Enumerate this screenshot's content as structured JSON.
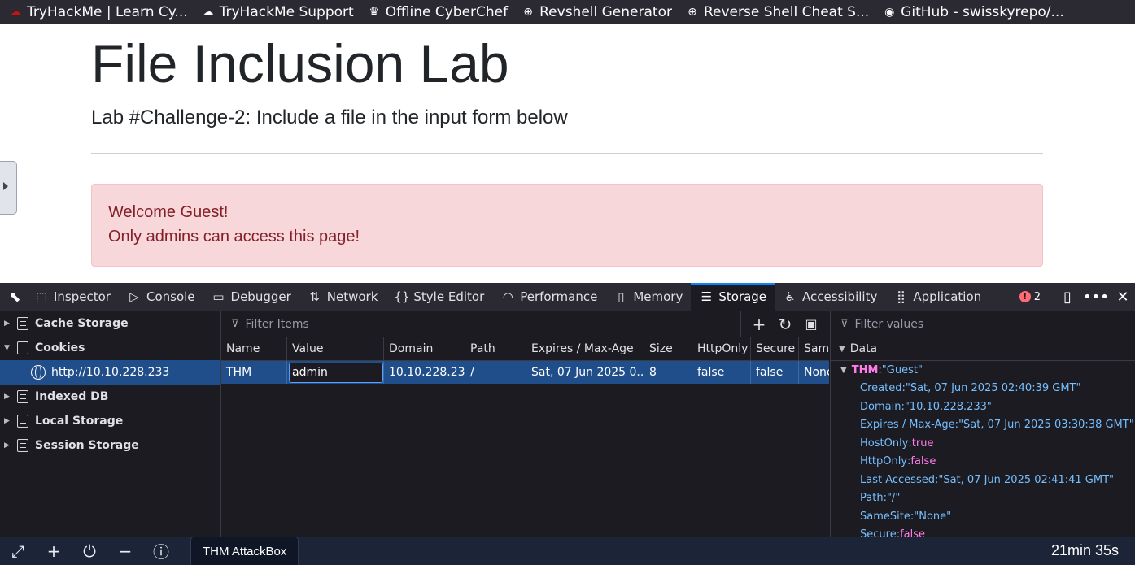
{
  "bookmarks": [
    {
      "icon": "tryhackme-icon",
      "label": "TryHackMe | Learn Cy..."
    },
    {
      "icon": "cloud-icon",
      "label": "TryHackMe Support"
    },
    {
      "icon": "chef-hat-icon",
      "label": "Offline CyberChef"
    },
    {
      "icon": "globe-icon",
      "label": "Revshell Generator"
    },
    {
      "icon": "globe-icon",
      "label": "Reverse Shell Cheat S..."
    },
    {
      "icon": "github-icon",
      "label": "GitHub - swisskyrepo/..."
    }
  ],
  "page": {
    "title": "File Inclusion Lab",
    "lead": "Lab #Challenge-2: Include a file in the input form below",
    "alert_line1": "Welcome Guest!",
    "alert_line2": "Only admins can access this page!"
  },
  "devtools": {
    "tabs": [
      {
        "name": "Inspector",
        "icon": "inspector-icon"
      },
      {
        "name": "Console",
        "icon": "console-icon"
      },
      {
        "name": "Debugger",
        "icon": "debugger-icon"
      },
      {
        "name": "Network",
        "icon": "network-icon"
      },
      {
        "name": "Style Editor",
        "icon": "style-editor-icon"
      },
      {
        "name": "Performance",
        "icon": "performance-icon"
      },
      {
        "name": "Memory",
        "icon": "memory-icon"
      },
      {
        "name": "Storage",
        "icon": "storage-icon",
        "active": true
      },
      {
        "name": "Accessibility",
        "icon": "accessibility-icon"
      },
      {
        "name": "Application",
        "icon": "application-icon"
      }
    ],
    "error_count": "2",
    "tree": {
      "cache_storage": "Cache Storage",
      "cookies": "Cookies",
      "cookie_host": "http://10.10.228.233",
      "indexed_db": "Indexed DB",
      "local_storage": "Local Storage",
      "session_storage": "Session Storage"
    },
    "filter_placeholder": "Filter Items",
    "columns": [
      "Name",
      "Value",
      "Domain",
      "Path",
      "Expires / Max-Age",
      "Size",
      "HttpOnly",
      "Secure",
      "Same"
    ],
    "row": {
      "name": "THM",
      "value": "admin",
      "domain": "10.10.228.233",
      "path": "/",
      "expires": "Sat, 07 Jun 2025 0...",
      "size": "8",
      "httponly": "false",
      "secure": "false",
      "samesite": "None"
    },
    "sidebar": {
      "filter_placeholder": "Filter values",
      "header": "Data",
      "root_key": "THM",
      "root_value": "\"Guest\"",
      "props": [
        {
          "key": "Created",
          "value": "\"Sat, 07 Jun 2025 02:40:39 GMT\"",
          "bool": false
        },
        {
          "key": "Domain",
          "value": "\"10.10.228.233\"",
          "bool": false
        },
        {
          "key": "Expires / Max-Age",
          "value": "\"Sat, 07 Jun 2025 03:30:38 GMT\"",
          "bool": false
        },
        {
          "key": "HostOnly",
          "value": "true",
          "bool": true
        },
        {
          "key": "HttpOnly",
          "value": "false",
          "bool": true
        },
        {
          "key": "Last Accessed",
          "value": "\"Sat, 07 Jun 2025 02:41:41 GMT\"",
          "bool": false
        },
        {
          "key": "Path",
          "value": "\"/\"",
          "bool": false
        },
        {
          "key": "SameSite",
          "value": "\"None\"",
          "bool": false
        },
        {
          "key": "Secure",
          "value": "false",
          "bool": true
        }
      ]
    }
  },
  "bottombar": {
    "tab_label": "THM AttackBox",
    "timer": "21min 35s"
  }
}
